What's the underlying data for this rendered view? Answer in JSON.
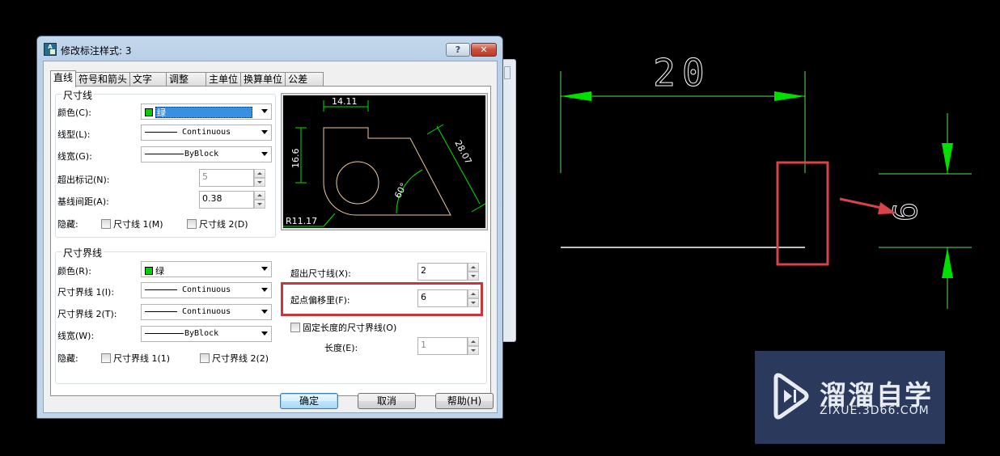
{
  "dialog": {
    "title": "修改标注样式: 3",
    "help_glyph": "?",
    "close_glyph": "✕",
    "tabs": [
      {
        "label": "直线",
        "active": true
      },
      {
        "label": "符号和箭头",
        "active": false
      },
      {
        "label": "文字",
        "active": false
      },
      {
        "label": "调整",
        "active": false
      },
      {
        "label": "主单位",
        "active": false
      },
      {
        "label": "换算单位",
        "active": false
      },
      {
        "label": "公差",
        "active": false
      }
    ],
    "dim_lines": {
      "legend": "尺寸线",
      "color_label": "颜色(C):",
      "color_value": "绿",
      "linetype_label": "线型(L):",
      "linetype_value": "Continuous",
      "lineweight_label": "线宽(G):",
      "lineweight_value": "ByBlock",
      "extend_ticks_label": "超出标记(N):",
      "extend_ticks_value": "5",
      "baseline_spacing_label": "基线间距(A):",
      "baseline_spacing_value": "0.38",
      "suppress_label": "隐藏:",
      "suppress_1": "尺寸线 1(M)",
      "suppress_2": "尺寸线 2(D)"
    },
    "ext_lines": {
      "legend": "尺寸界线",
      "color_label": "颜色(R):",
      "color_value": "绿",
      "linetype1_label": "尺寸界线 1(I):",
      "linetype1_value": "Continuous",
      "linetype2_label": "尺寸界线 2(T):",
      "linetype2_value": "Continuous",
      "lineweight_label": "线宽(W):",
      "lineweight_value": "ByBlock",
      "suppress_label": "隐藏:",
      "suppress_1": "尺寸界线 1(1)",
      "suppress_2": "尺寸界线 2(2)",
      "extend_beyond_label": "超出尺寸线(X):",
      "extend_beyond_value": "2",
      "offset_origin_label": "起点偏移里(F):",
      "offset_origin_value": "6",
      "fixed_length_label": "固定长度的尺寸界线(O)",
      "length_label": "长度(E):",
      "length_value": "1"
    },
    "preview": {
      "dim_top": "14.11",
      "dim_left": "16.6",
      "dim_slant": "28.07",
      "dim_angle": "60°",
      "dim_radius": "R11.17"
    },
    "buttons": {
      "ok": "确定",
      "cancel": "取消",
      "help": "帮助(H)"
    }
  },
  "canvas": {
    "dim_horizontal_text": "20",
    "dim_vertical_text": "6",
    "colors": {
      "dimension": "#00e000",
      "geometry": "#ffffff",
      "annotation": "#d9434a",
      "background": "#000000"
    }
  },
  "watermark": {
    "brand": "溜溜自学",
    "url": "ZIXUE.3D66.COM"
  }
}
